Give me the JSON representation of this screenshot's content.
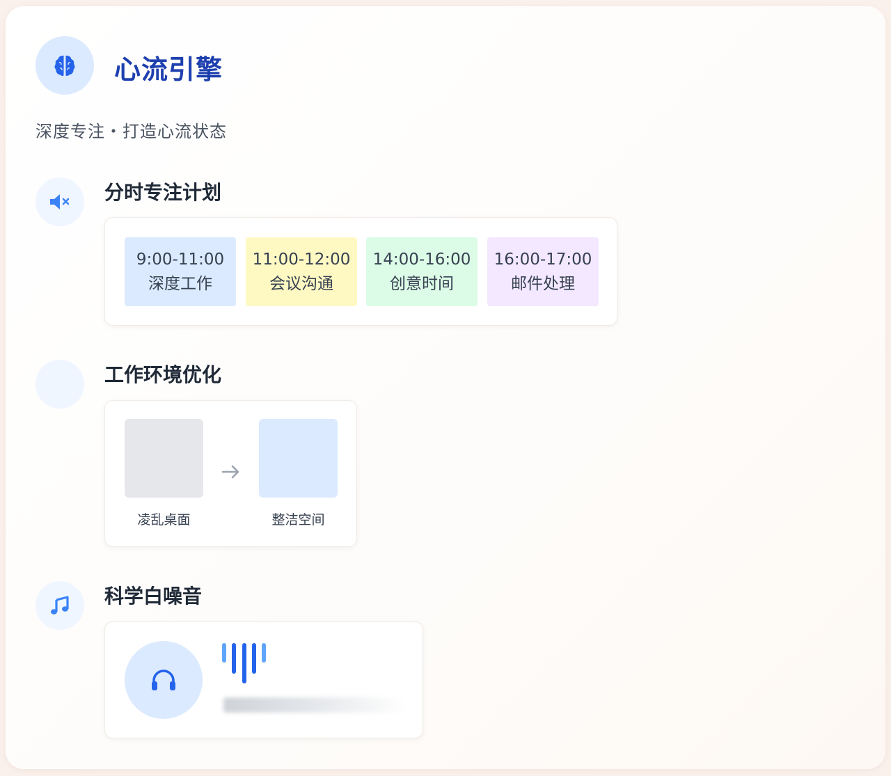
{
  "app": {
    "title": "心流引擎",
    "subtitle": "深度专注・打造心流状态",
    "logo_icon": "brain-icon",
    "brand_color": "#1e40af"
  },
  "schedule": {
    "title": "分时专注计划",
    "icon": "muted-speaker-icon",
    "slots": [
      {
        "time": "9:00-11:00",
        "label": "深度工作",
        "color": "#dbeafe"
      },
      {
        "time": "11:00-12:00",
        "label": "会议沟通",
        "color": "#fef9c3"
      },
      {
        "time": "14:00-16:00",
        "label": "创意时间",
        "color": "#dcfce7"
      },
      {
        "time": "16:00-17:00",
        "label": "邮件处理",
        "color": "#f3e8ff"
      }
    ]
  },
  "environment": {
    "title": "工作环境优化",
    "before_label": "凌乱桌面",
    "after_label": "整洁空间",
    "before_color": "#e5e7eb",
    "after_color": "#dbeafe",
    "arrow_icon": "arrow-right-icon"
  },
  "noise": {
    "title": "科学白噪音",
    "icon": "music-note-icon",
    "player_icon": "headphones-icon",
    "waveform_icon": "sound-wave-icon"
  }
}
